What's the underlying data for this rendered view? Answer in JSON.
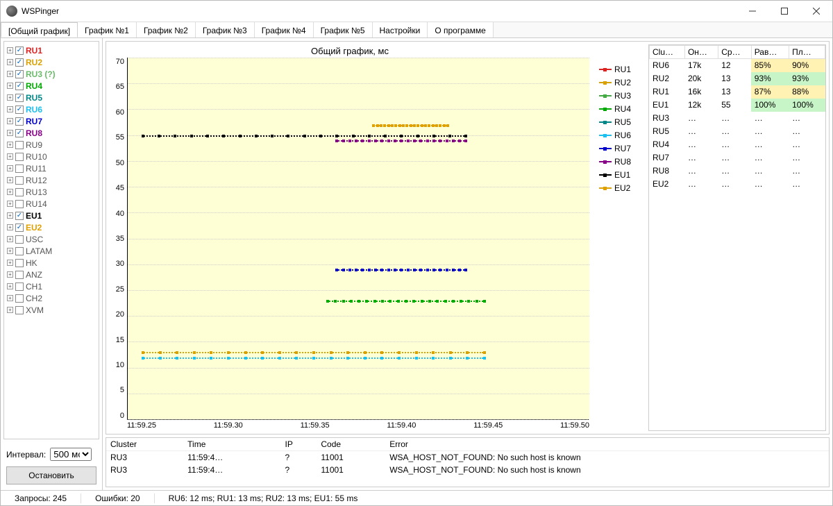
{
  "window": {
    "title": "WSPinger"
  },
  "tabs": [
    "[Общий график]",
    "График №1",
    "График №2",
    "График №3",
    "График №4",
    "График №5",
    "Настройки",
    "О программе"
  ],
  "active_tab": 0,
  "tree": [
    {
      "label": "RU1",
      "checked": true,
      "color": "#d22"
    },
    {
      "label": "RU2",
      "checked": true,
      "color": "#d8a000"
    },
    {
      "label": "RU3 (?)",
      "checked": true,
      "color": "#4a4",
      "faded": true
    },
    {
      "label": "RU4",
      "checked": true,
      "color": "#0a0"
    },
    {
      "label": "RU5",
      "checked": true,
      "color": "#088"
    },
    {
      "label": "RU6",
      "checked": true,
      "color": "#1ac0f0"
    },
    {
      "label": "RU7",
      "checked": true,
      "color": "#00c"
    },
    {
      "label": "RU8",
      "checked": true,
      "color": "#808"
    },
    {
      "label": "RU9",
      "checked": false,
      "color": "#555"
    },
    {
      "label": "RU10",
      "checked": false,
      "color": "#555"
    },
    {
      "label": "RU11",
      "checked": false,
      "color": "#555"
    },
    {
      "label": "RU12",
      "checked": false,
      "color": "#555"
    },
    {
      "label": "RU13",
      "checked": false,
      "color": "#555"
    },
    {
      "label": "RU14",
      "checked": false,
      "color": "#555"
    },
    {
      "label": "EU1",
      "checked": true,
      "color": "#000"
    },
    {
      "label": "EU2",
      "checked": true,
      "color": "#e0a000"
    },
    {
      "label": "USC",
      "checked": false,
      "color": "#555"
    },
    {
      "label": "LATAM",
      "checked": false,
      "color": "#555"
    },
    {
      "label": "HK",
      "checked": false,
      "color": "#555"
    },
    {
      "label": "ANZ",
      "checked": false,
      "color": "#555"
    },
    {
      "label": "CH1",
      "checked": false,
      "color": "#555"
    },
    {
      "label": "CH2",
      "checked": false,
      "color": "#555"
    },
    {
      "label": "XVM",
      "checked": false,
      "color": "#555"
    }
  ],
  "interval": {
    "label": "Интервал:",
    "value": "500 мс"
  },
  "stop_label": "Остановить",
  "chart_data": {
    "type": "line",
    "title": "Общий график, мс",
    "ylim": [
      0,
      70
    ],
    "y_ticks": [
      0,
      5,
      10,
      15,
      20,
      25,
      30,
      35,
      40,
      45,
      50,
      55,
      60,
      65,
      70
    ],
    "x_ticks": [
      "11:59.25",
      "11:59.30",
      "11:59.35",
      "11:59.40",
      "11:59.45",
      "11:59.50"
    ],
    "series": [
      {
        "name": "RU1",
        "color": "#d22",
        "y": 13,
        "x0": 0.03,
        "x1": 0.77
      },
      {
        "name": "RU2",
        "color": "#d8a000",
        "y": 13,
        "x0": 0.03,
        "x1": 0.77
      },
      {
        "name": "RU3",
        "color": "#4a4",
        "y": 23,
        "x0": 0.43,
        "x1": 0.77
      },
      {
        "name": "RU4",
        "color": "#0a0",
        "y": 23,
        "x0": 0.43,
        "x1": 0.77
      },
      {
        "name": "RU5",
        "color": "#088",
        "y": 12,
        "x0": 0.03,
        "x1": 0.77
      },
      {
        "name": "RU6",
        "color": "#1ac0f0",
        "y": 12,
        "x0": 0.03,
        "x1": 0.77
      },
      {
        "name": "RU7",
        "color": "#00c",
        "y": 29,
        "x0": 0.45,
        "x1": 0.73
      },
      {
        "name": "RU8",
        "color": "#808",
        "y": 54,
        "x0": 0.45,
        "x1": 0.73
      },
      {
        "name": "EU1",
        "color": "#000",
        "y": 55,
        "x0": 0.03,
        "x1": 0.73
      },
      {
        "name": "EU2",
        "color": "#e0a000",
        "y": 57,
        "x0": 0.53,
        "x1": 0.69
      }
    ]
  },
  "stats": {
    "cols": [
      "Clu…",
      "Он…",
      "Ср…",
      "Рав…",
      "Пл…"
    ],
    "rows": [
      {
        "c": "RU6",
        "o": "17k",
        "s": "12",
        "r": "85%",
        "p": "90%",
        "hr": "y",
        "hp": "y"
      },
      {
        "c": "RU2",
        "o": "20k",
        "s": "13",
        "r": "93%",
        "p": "93%",
        "hr": "g",
        "hp": "g"
      },
      {
        "c": "RU1",
        "o": "16k",
        "s": "13",
        "r": "87%",
        "p": "88%",
        "hr": "y",
        "hp": "y"
      },
      {
        "c": "EU1",
        "o": "12k",
        "s": "55",
        "r": "100%",
        "p": "100%",
        "hr": "g",
        "hp": "g"
      },
      {
        "c": "RU3",
        "o": "…",
        "s": "…",
        "r": "…",
        "p": "…"
      },
      {
        "c": "RU5",
        "o": "…",
        "s": "…",
        "r": "…",
        "p": "…"
      },
      {
        "c": "RU4",
        "o": "…",
        "s": "…",
        "r": "…",
        "p": "…"
      },
      {
        "c": "RU7",
        "o": "…",
        "s": "…",
        "r": "…",
        "p": "…"
      },
      {
        "c": "RU8",
        "o": "…",
        "s": "…",
        "r": "…",
        "p": "…"
      },
      {
        "c": "EU2",
        "o": "…",
        "s": "…",
        "r": "…",
        "p": "…"
      }
    ]
  },
  "errorlog": {
    "cols": [
      "Cluster",
      "Time",
      "IP",
      "Code",
      "Error"
    ],
    "rows": [
      {
        "Cluster": "RU3",
        "Time": "11:59:4…",
        "IP": "?",
        "Code": "11001",
        "Error": "WSA_HOST_NOT_FOUND: No such host is known"
      },
      {
        "Cluster": "RU3",
        "Time": "11:59:4…",
        "IP": "?",
        "Code": "11001",
        "Error": "WSA_HOST_NOT_FOUND: No such host is known"
      }
    ]
  },
  "status": {
    "requests": "Запросы: 245",
    "errors": "Ошибки: 20",
    "summary": "RU6: 12 ms; RU1: 13 ms; RU2: 13 ms; EU1: 55 ms"
  }
}
